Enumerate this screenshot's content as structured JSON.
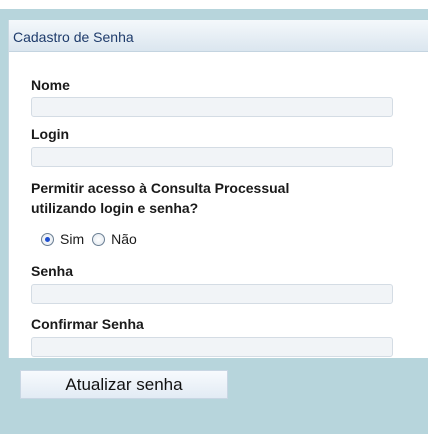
{
  "panel": {
    "title": "Cadastro de Senha"
  },
  "form": {
    "name_label": "Nome",
    "name_value": "",
    "login_label": "Login",
    "login_value": "",
    "access_question_line1": "Permitir acesso à Consulta Processual",
    "access_question_line2": "utilizando login e senha?",
    "access_options": [
      "Sim",
      "Não"
    ],
    "access_selected": "Sim",
    "password_label": "Senha",
    "password_value": "",
    "confirm_label": "Confirmar Senha",
    "confirm_value": ""
  },
  "actions": {
    "update_password": "Atualizar senha"
  },
  "colors": {
    "background": "#b7d5dc",
    "header_text": "#1e3b6b",
    "radio_selected": "#1f4fd0"
  }
}
